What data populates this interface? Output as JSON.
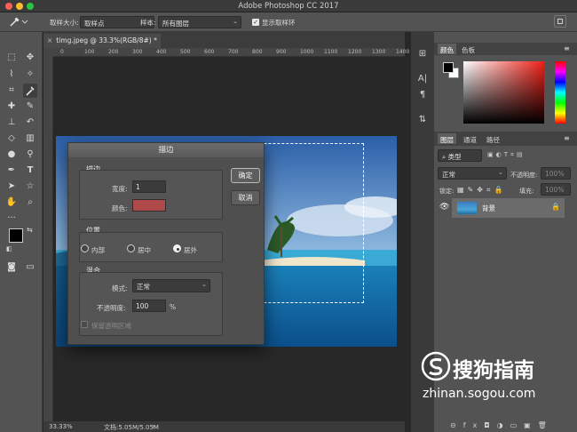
{
  "app": {
    "title": "Adobe Photoshop CC 2017"
  },
  "options_bar": {
    "sample_size_label": "取样大小:",
    "sample_size_value": "取样点",
    "sample_label": "样本:",
    "sample_value": "所有图层",
    "show_ring_label": "显示取样环"
  },
  "document": {
    "tab_title": "timg.jpeg @ 33.3%(RGB/8#) *",
    "ruler_ticks": [
      "0",
      "100",
      "200",
      "300",
      "400",
      "500",
      "600",
      "700",
      "800",
      "900",
      "1000",
      "1100",
      "1200",
      "1300",
      "1400"
    ],
    "zoom": "33.33%",
    "doc_info": "文档:5.05M/5.05M"
  },
  "color_panel": {
    "tabs": [
      "颜色",
      "色板"
    ],
    "foreground": "#000000",
    "background": "#ffffff"
  },
  "layers_panel": {
    "tabs": [
      "图层",
      "通道",
      "路径"
    ],
    "kind_filter": "类型",
    "blend_mode": "正常",
    "opacity_label": "不透明度:",
    "opacity_value": "100%",
    "lock_label": "锁定:",
    "fill_label": "填充:",
    "fill_value": "100%",
    "layer_name": "背景"
  },
  "stroke_dialog": {
    "title": "描边",
    "stroke_section": "描边",
    "width_label": "宽度:",
    "width_value": "1",
    "color_label": "颜色:",
    "stroke_color": "#b04a4a",
    "ok": "确定",
    "cancel": "取消",
    "location_section": "位置",
    "location_options": [
      "内部",
      "居中",
      "居外"
    ],
    "location_selected": "居外",
    "blend_section": "混合",
    "mode_label": "模式:",
    "mode_value": "正常",
    "opacity_label": "不透明度:",
    "opacity_value": "100",
    "percent": "%",
    "preserve_label": "保留透明区域"
  },
  "watermark": {
    "brand": "搜狗指南",
    "url": "zhinan.sogou.com"
  }
}
